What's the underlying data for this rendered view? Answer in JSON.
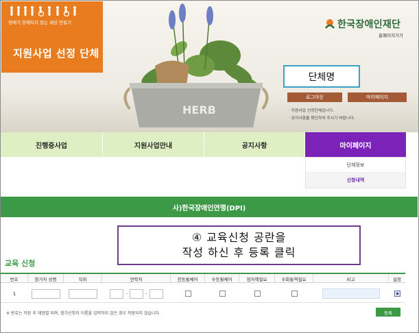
{
  "header": {
    "slogan": "장애가 장애되지 않는 세상 만들기",
    "org_title": "지원사업 선정 단체",
    "brand_name": "한국장애인재단",
    "home_link": "홈페이지가기",
    "org_name": "단체명",
    "logout_label": "로그아웃",
    "mypage_label": "마이페이지",
    "notice_1": "· 지원사업 선정단체입니다.",
    "notice_2": "· 공지사항을 확인하여 주시기 바랍니다.",
    "pot_text": "HERB"
  },
  "nav": {
    "items": [
      {
        "label": "진행중사업"
      },
      {
        "label": "지원사업안내"
      },
      {
        "label": "공지사항"
      },
      {
        "label": "마이페이지"
      }
    ],
    "active_index": 3
  },
  "submenu": {
    "items": [
      {
        "label": "단체정보"
      },
      {
        "label": "신청내역"
      }
    ]
  },
  "banner": {
    "title": "사)한국장애인연맹(DPI)"
  },
  "callout": {
    "line1": "④ 교육신청 공란을",
    "line2": "작성 하신 후 등록 클릭"
  },
  "section": {
    "title": "교육 신청"
  },
  "table": {
    "headers": [
      "번호",
      "참가자 성명",
      "직위",
      "연락처",
      "전동휠체어",
      "수동휠체어",
      "점자책필요",
      "수화통역필요",
      "비고",
      "설정"
    ],
    "rows": [
      {
        "number": "1"
      }
    ],
    "phone_separator": "-"
  },
  "footer": {
    "note": "※ 번호는 저장 후 재정렬 되며, 참가신청자 이름을 입력하지 않은 경우 저장되지 않습니다.",
    "register_label": "등록"
  },
  "colors": {
    "orange": "#e87c1e",
    "green": "#3c9a46",
    "purple": "#7b22b8",
    "nav_bg": "#dfefc4",
    "button_brown": "#a25a37"
  }
}
